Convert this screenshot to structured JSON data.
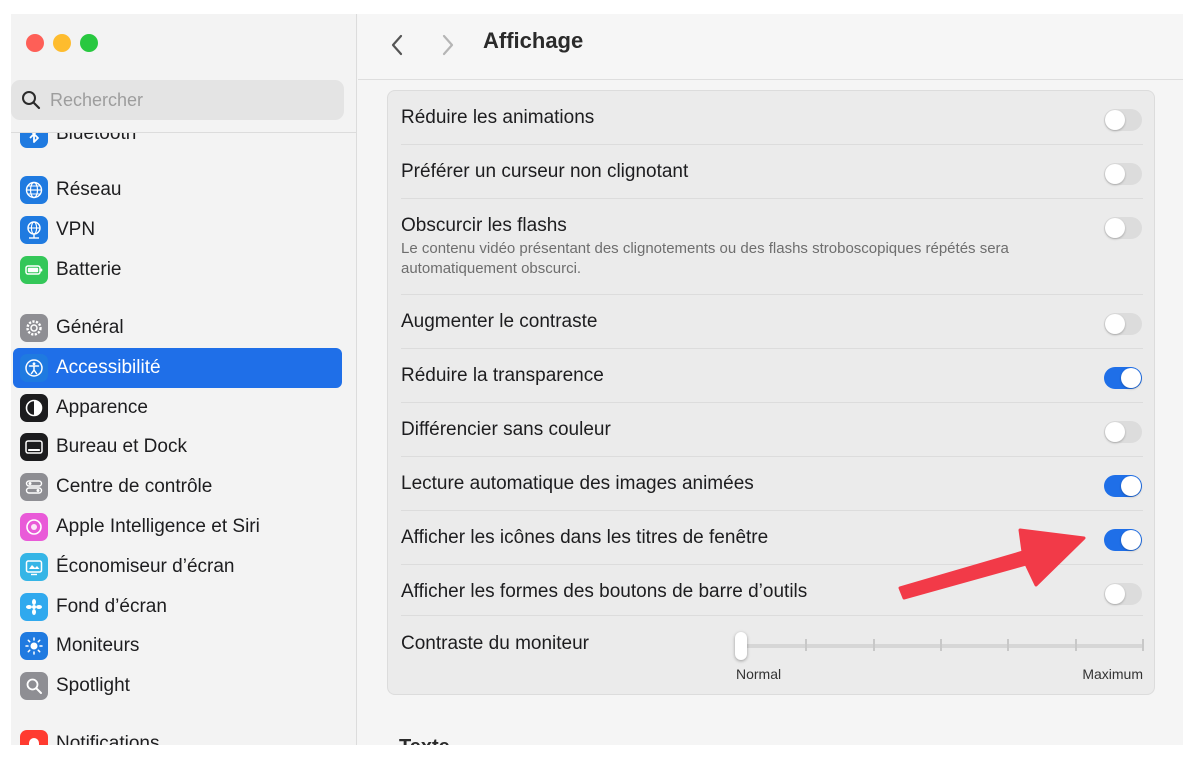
{
  "window": {
    "traffic_colors": [
      "#fe5f57",
      "#febc2e",
      "#28c840"
    ]
  },
  "sidebar": {
    "search": {
      "placeholder": "Rechercher",
      "value": ""
    },
    "items": [
      {
        "label": "Bluetooth",
        "icon": "bluetooth-icon",
        "color": "#1f7ae0",
        "active": false
      },
      {
        "label": "Réseau",
        "icon": "globe-icon",
        "color": "#1f7ae0",
        "active": false
      },
      {
        "label": "VPN",
        "icon": "globe-network-icon",
        "color": "#1f7ae0",
        "active": false
      },
      {
        "label": "Batterie",
        "icon": "battery-icon",
        "color": "#34c759",
        "active": false
      },
      {
        "label": "Général",
        "icon": "gear-icon",
        "color": "#8e8e93",
        "active": false
      },
      {
        "label": "Accessibilité",
        "icon": "accessibility-icon",
        "color": "#1f7ae0",
        "active": true
      },
      {
        "label": "Apparence",
        "icon": "appearance-icon",
        "color": "#1c1c1e",
        "active": false
      },
      {
        "label": "Bureau et Dock",
        "icon": "dock-icon",
        "color": "#1c1c1e",
        "active": false
      },
      {
        "label": "Centre de contrôle",
        "icon": "control-center-icon",
        "color": "#8e8e93",
        "active": false
      },
      {
        "label": "Apple Intelligence et Siri",
        "icon": "siri-icon",
        "color": "#e95ad8",
        "active": false
      },
      {
        "label": "Économiseur d’écran",
        "icon": "screensaver-icon",
        "color": "#35b5e6",
        "active": false
      },
      {
        "label": "Fond d’écran",
        "icon": "wallpaper-icon",
        "color": "#30a9ee",
        "active": false
      },
      {
        "label": "Moniteurs",
        "icon": "sun-icon",
        "color": "#1f7ae0",
        "active": false
      },
      {
        "label": "Spotlight",
        "icon": "spotlight-icon",
        "color": "#8e8e93",
        "active": false
      },
      {
        "label": "Notifications",
        "icon": "bell-icon",
        "color": "#ff3b30",
        "active": false
      }
    ]
  },
  "header": {
    "title": "Affichage"
  },
  "settings": {
    "rows": [
      {
        "label": "Réduire les animations",
        "on": false
      },
      {
        "label": "Préférer un curseur non clignotant",
        "on": false
      },
      {
        "label": "Obscurcir les flashs",
        "description": "Le contenu vidéo présentant des clignotements ou des flashs stroboscopiques répétés sera automatiquement obscurci.",
        "on": false
      },
      {
        "label": "Augmenter le contraste",
        "on": false
      },
      {
        "label": "Réduire la transparence",
        "on": true
      },
      {
        "label": "Différencier sans couleur",
        "on": false
      },
      {
        "label": "Lecture automatique des images animées",
        "on": true
      },
      {
        "label": "Afficher les icônes dans les titres de fenêtre",
        "on": true
      },
      {
        "label": "Afficher les formes des boutons de barre d’outils",
        "on": false
      }
    ],
    "contrast": {
      "label": "Contraste du moniteur",
      "min_label": "Normal",
      "max_label": "Maximum",
      "value": 0
    }
  },
  "next_section_cut": "Texte",
  "accent_color": "#1f6fe8",
  "annotation_arrow_color": "#f23a48"
}
